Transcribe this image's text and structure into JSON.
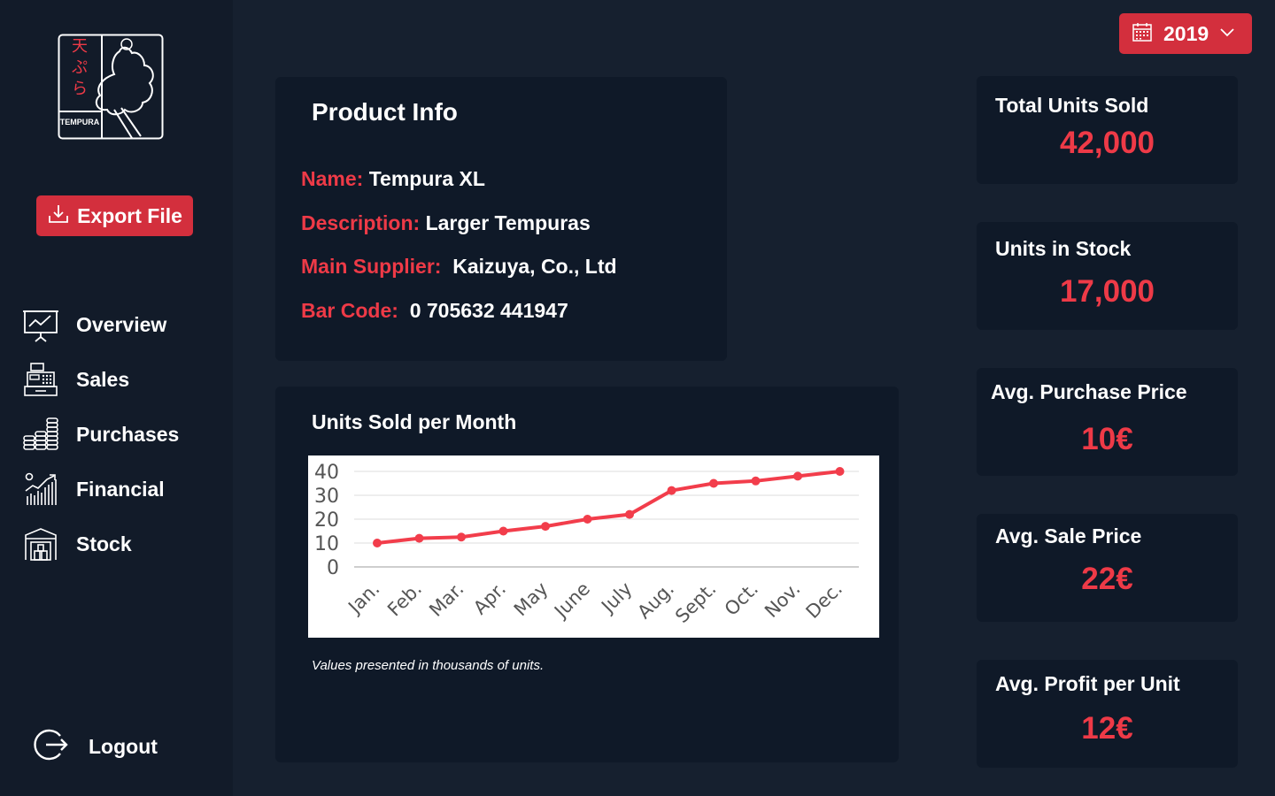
{
  "brand": {
    "logo_text": "TEMPURA",
    "logo_kana": "天ぷら",
    "accent": "#d32f3d",
    "value_color": "#ee3a47"
  },
  "sidebar": {
    "export_label": "Export File",
    "items": [
      {
        "label": "Overview",
        "icon": "presentation-chart-icon"
      },
      {
        "label": "Sales",
        "icon": "cash-register-icon"
      },
      {
        "label": "Purchases",
        "icon": "coin-stacks-icon"
      },
      {
        "label": "Financial",
        "icon": "growth-chart-icon"
      },
      {
        "label": "Stock",
        "icon": "warehouse-icon"
      }
    ],
    "logout_label": "Logout"
  },
  "year_selector": {
    "value": "2019"
  },
  "product_info": {
    "title": "Product Info",
    "name_label": "Name:",
    "name_value": "Tempura XL",
    "description_label": "Description:",
    "description_value": "Larger Tempuras",
    "supplier_label": "Main Supplier:",
    "supplier_value": "Kaizuya, Co., Ltd",
    "barcode_label": "Bar Code:",
    "barcode_value": "0 705632 441947"
  },
  "chart_card": {
    "title": "Units Sold per Month",
    "note": "Values presented in thousands of units."
  },
  "chart_data": {
    "type": "line",
    "categories": [
      "Jan.",
      "Feb.",
      "Mar.",
      "Apr.",
      "May",
      "June",
      "July",
      "Aug.",
      "Sept.",
      "Oct.",
      "Nov.",
      "Dec."
    ],
    "values": [
      10,
      12,
      12.5,
      15,
      17,
      20,
      22,
      32,
      35,
      36,
      38,
      40
    ],
    "yticks": [
      0,
      10,
      20,
      30,
      40
    ],
    "ylim": [
      0,
      40
    ],
    "grid": true,
    "line_color": "#f23d4b"
  },
  "kpis": [
    {
      "title": "Total Units Sold",
      "value": "42,000"
    },
    {
      "title": "Units in Stock",
      "value": "17,000"
    },
    {
      "title": "Avg. Purchase Price",
      "value": "10€"
    },
    {
      "title": "Avg. Sale Price",
      "value": "22€"
    },
    {
      "title": "Avg. Profit per Unit",
      "value": "12€"
    }
  ]
}
